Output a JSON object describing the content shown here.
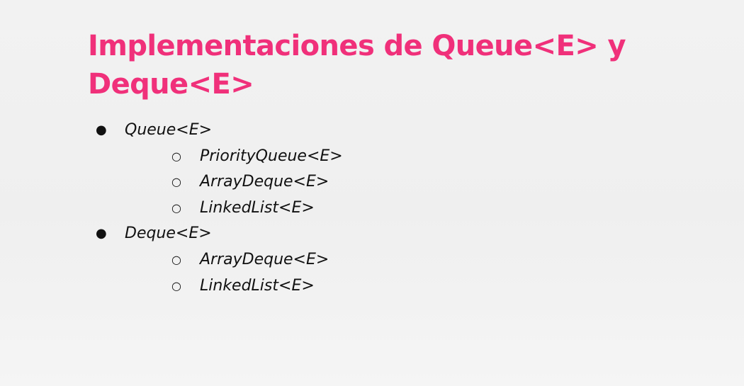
{
  "slide": {
    "title": "Implementaciones de Queue<E> y Deque<E>",
    "items": [
      {
        "level": 1,
        "bullet": "●",
        "text": "Queue<E>"
      },
      {
        "level": 2,
        "bullet": "○",
        "text": "PriorityQueue<E>"
      },
      {
        "level": 2,
        "bullet": "○",
        "text": "ArrayDeque<E>"
      },
      {
        "level": 2,
        "bullet": "○",
        "text": "LinkedList<E>"
      },
      {
        "level": 1,
        "bullet": "●",
        "text": "Deque<E>"
      },
      {
        "level": 2,
        "bullet": "○",
        "text": "ArrayDeque<E>"
      },
      {
        "level": 2,
        "bullet": "○",
        "text": "LinkedList<E>"
      }
    ]
  },
  "colors": {
    "title": "#f0307a",
    "text": "#111111",
    "background": "#f1f1f1"
  }
}
